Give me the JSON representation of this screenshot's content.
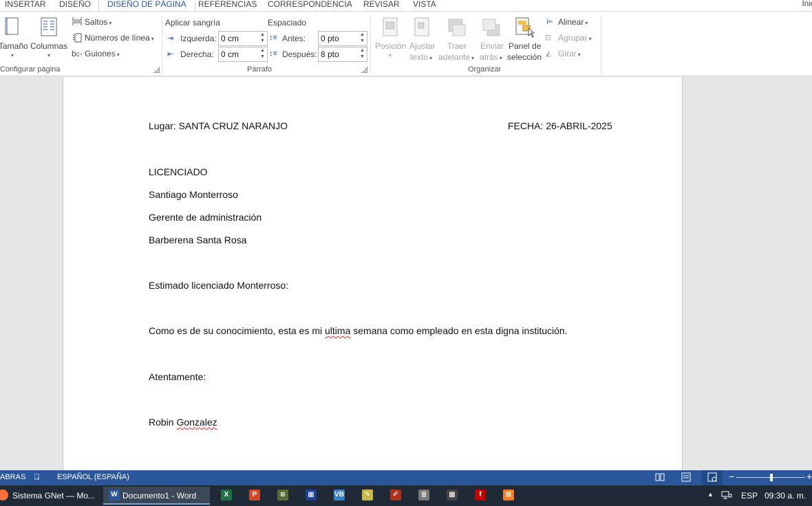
{
  "tabs": {
    "insertar": "INSERTAR",
    "diseno": "DISEÑO",
    "diseno_pagina": "DISEÑO DE PÁGINA",
    "referencias": "REFERENCIAS",
    "correspondencia": "CORRESPONDENCIA",
    "revisar": "REVISAR",
    "vista": "VISTA",
    "inicio_partial": "Inic"
  },
  "ribbon": {
    "configurar": {
      "tamano": "Tamaño",
      "columnas": "Columnas",
      "saltos": "Saltos",
      "numeros_linea": "Números de línea",
      "guiones": "Guiones",
      "group_label": "Configurar página"
    },
    "parrafo": {
      "aplicar_sangria": "Aplicar sangría",
      "izquierda_label": "Izquierda:",
      "izquierda_value": "0 cm",
      "derecha_label": "Derecha:",
      "derecha_value": "0 cm",
      "espaciado": "Espaciado",
      "antes_label": "Antes:",
      "antes_value": "0 pto",
      "despues_label": "Después:",
      "despues_value": "8 pto",
      "group_label": "Párrafo"
    },
    "organizar": {
      "posicion": "Posición",
      "ajustar_1": "Ajustar",
      "ajustar_2": "texto",
      "traer_1": "Traer",
      "traer_2": "adelante",
      "enviar_1": "Enviar",
      "enviar_2": "atrás",
      "panel_1": "Panel de",
      "panel_2": "selección",
      "alinear": "Alinear",
      "agrupar": "Agrupar",
      "girar": "Girar",
      "group_label": "Organizar"
    }
  },
  "document": {
    "lugar": "Lugar: SANTA CRUZ NARANJO",
    "fecha": "FECHA: 26-ABRIL-2025",
    "line1": "LICENCIADO",
    "line2": "Santiago Monterroso",
    "line3": "Gerente de administración",
    "line4": "Barberena Santa Rosa",
    "saludo": "Estimado licenciado Monterroso:",
    "body_a": "Como es de su conocimiento, esta es mi ",
    "body_err": "ultima",
    "body_b": " semana como empleado en esta digna institución.",
    "cierre": "Atentamente:",
    "firma_1": "Robin ",
    "firma_2": "Gonzalez"
  },
  "status": {
    "palabras_partial": "ABRAS",
    "idioma": "ESPAÑOL (ESPAÑA)"
  },
  "taskbar": {
    "firefox_label": "Sistema GNet — Mo...",
    "word_label": "Documento1 - Word",
    "lang": "ESP",
    "time": "09:30 a. m."
  },
  "colors": {
    "word_blue": "#2b579a",
    "taskbar": "#1f2a36",
    "excel": "#217346",
    "powerpoint": "#d24726",
    "filezilla": "#bf0000",
    "xampp": "#fb7a24"
  }
}
